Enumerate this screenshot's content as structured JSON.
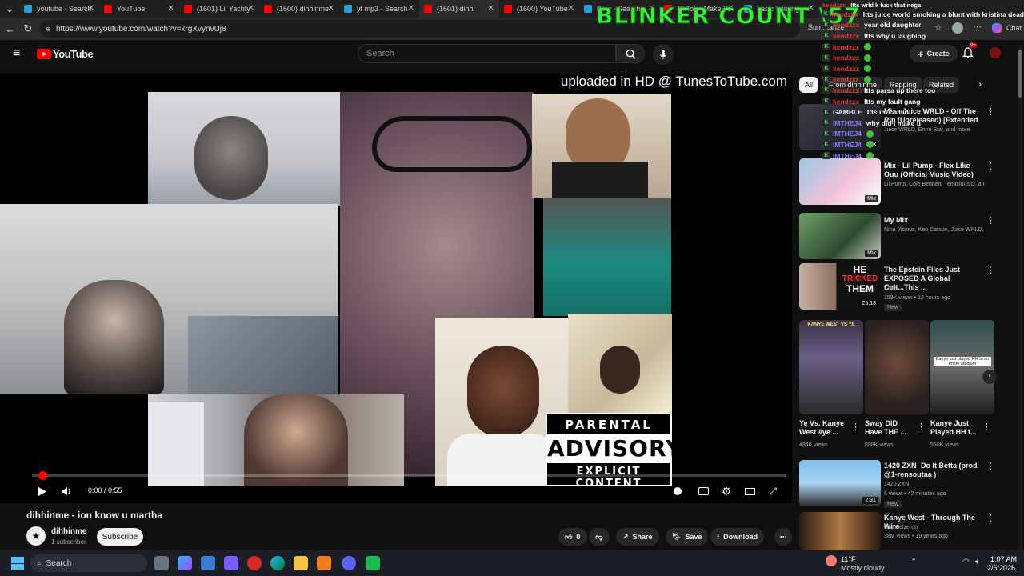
{
  "browser": {
    "tabs": [
      {
        "label": "youtube - Search",
        "favicon": "bing"
      },
      {
        "label": "YouTube",
        "favicon": "yt"
      },
      {
        "label": "(1601) Lil Yachty",
        "favicon": "yt"
      },
      {
        "label": "(1600) dihhinme",
        "favicon": "yt"
      },
      {
        "label": "yt mp3 - Search",
        "favicon": "bing"
      },
      {
        "label": "(1601) dihhi",
        "favicon": "yt",
        "active": true
      },
      {
        "label": "(1600) YouTube",
        "favicon": "yt"
      },
      {
        "label": "Bing - Search",
        "favicon": "bing"
      },
      {
        "label": "TikTok - Make Yo",
        "favicon": "yt"
      },
      {
        "label": "basic training car",
        "favicon": "bing"
      }
    ],
    "url": "https://www.youtube.com/watch?v=krgXvynvUj8",
    "summarize_label": "Summarize",
    "chat_label": "Chat"
  },
  "youtube": {
    "logo_text": "YouTube",
    "search_placeholder": "Search",
    "create_label": "Create",
    "notification_count": "9+"
  },
  "player": {
    "watermark": "uploaded in HD @ TunesToTube.com",
    "advisory": {
      "line1": "PARENTAL",
      "line2": "ADVISORY",
      "line3": "EXPLICIT CONTENT"
    },
    "time_display": "0:00 / 0:55",
    "progress": 0.0
  },
  "video": {
    "title": "dihhinme - ion know u martha",
    "channel": "dihhinme",
    "subscribers": "1 subscriber",
    "subscribe_label": "Subscribe",
    "likes": "0",
    "share_label": "Share",
    "save_label": "Save",
    "download_label": "Download"
  },
  "chips": [
    {
      "label": "All",
      "active": true
    },
    {
      "label": "From dihhinme"
    },
    {
      "label": "Rapping"
    },
    {
      "label": "Related"
    }
  ],
  "recommendations": [
    {
      "title": "Mix - Juice WRLD - Off The Rip (Unreleased) [Extended Freestyle]",
      "meta1": "Juice WRLD, Emre Star, and more",
      "badge": "Mix"
    },
    {
      "title": "Mix - Lil Pump - Flex Like Ouu (Official Music Video)",
      "meta1": "Lil Pump, Cole Bennett, Tenacious D, and...",
      "badge": "Mix"
    },
    {
      "title": "My Mix",
      "meta1": "Nine Vicious, Ken Carson, Juice WRLD, a...",
      "badge": "Mix"
    },
    {
      "title": "The Epstein Files Just EXPOSED A Global Cult...This ...",
      "meta1": "Zaffy",
      "meta2": "159K views • 12 hours ago",
      "duration": "25:18",
      "new": "New",
      "thumb_text": [
        "HE",
        "TRICKED",
        "THEM"
      ]
    },
    {
      "title": "1420 ZXN- Do It Betta (prod @1-rensoutaa )",
      "meta1": "1420 ZXN",
      "meta2": "6 views • 42 minutes ago",
      "duration": "2:31",
      "new": "New"
    },
    {
      "title": "Kanye West - Through The Wire",
      "meta1": "channelzerotv",
      "meta2": "38M views • 19 years ago"
    }
  ],
  "shorts": [
    {
      "title": "Ye Vs. Kanye West #ye ...",
      "views": "494K views",
      "thumb_caption": "KANYE WEST VS YE"
    },
    {
      "title": "Sway DID Have THE ...",
      "views": "898K views"
    },
    {
      "title": "Kanye Just Played HH t...",
      "views": "550K views",
      "thumb_caption": "Kanye just played HH to an entire stadium"
    }
  ],
  "overlay": {
    "blinker": "BLINKER COUNT \\57",
    "chat": [
      {
        "user": "kendzzx",
        "color": "#e63b3b",
        "msg": "Itts juice world smoking a blunt with kristina dead"
      },
      {
        "user": "kendzzx",
        "color": "#e63b3b",
        "msg": "year old daughter"
      },
      {
        "user": "kendzzx",
        "color": "#e63b3b",
        "msg": "Itts why u laughing"
      },
      {
        "user": "kendzzx",
        "color": "#e63b3b",
        "msg": ""
      },
      {
        "user": "kendzzx",
        "color": "#e63b3b",
        "msg": ""
      },
      {
        "user": "kendzzx",
        "color": "#e63b3b",
        "msg": ""
      },
      {
        "user": "kendzzx",
        "color": "#e63b3b",
        "msg": ""
      },
      {
        "user": "kendzzx",
        "color": "#e63b3b",
        "msg": "Itts parsa up there too"
      },
      {
        "user": "kendzzx",
        "color": "#e63b3b",
        "msg": "Itts my fault gang"
      },
      {
        "user": "GAMBLE",
        "color": "#e8e8e8",
        "msg": "Itts im chillin"
      },
      {
        "user": "IMTHEJ4",
        "color": "#8a7cff",
        "msg": "why did i make u"
      },
      {
        "user": "IMTHEJ4",
        "color": "#8a7cff",
        "msg": ""
      },
      {
        "user": "IMTHEJ4",
        "color": "#8a7cff",
        "msg": ""
      },
      {
        "user": "IMTHEJ4",
        "color": "#8a7cff",
        "msg": ""
      }
    ],
    "chat_top": {
      "user": "kendzzx",
      "msg": "Itts wrld k fuck that nega"
    }
  },
  "taskbar": {
    "search_label": "Search",
    "weather_temp": "11°F",
    "weather_desc": "Mostly cloudy",
    "time": "1:07 AM",
    "date": "2/5/2026"
  }
}
